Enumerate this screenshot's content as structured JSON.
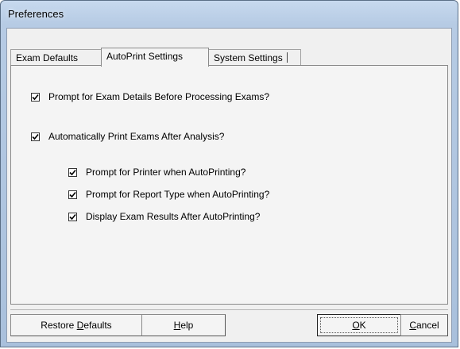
{
  "window": {
    "title": "Preferences"
  },
  "tabs": [
    {
      "label": "Exam Defaults",
      "active": false
    },
    {
      "label": "AutoPrint Settings",
      "active": true
    },
    {
      "label": "System Settings",
      "active": false
    }
  ],
  "checkboxes": {
    "prompt_exam_details": {
      "label": "Prompt for Exam Details Before Processing Exams?",
      "checked": true
    },
    "auto_print": {
      "label": "Automatically Print Exams After Analysis?",
      "checked": true
    },
    "prompt_printer": {
      "label": "Prompt for Printer when AutoPrinting?",
      "checked": true
    },
    "prompt_report_type": {
      "label": "Prompt for Report Type when AutoPrinting?",
      "checked": true
    },
    "display_results": {
      "label": "Display Exam Results After AutoPrinting?",
      "checked": true
    }
  },
  "buttons": {
    "restore_pre": "Restore ",
    "restore_key": "D",
    "restore_post": "efaults",
    "help_key": "H",
    "help_post": "elp",
    "ok_key": "O",
    "ok_post": "K",
    "cancel_key": "C",
    "cancel_post": "ancel"
  },
  "icons": {
    "checkmark": "checkmark-icon"
  }
}
